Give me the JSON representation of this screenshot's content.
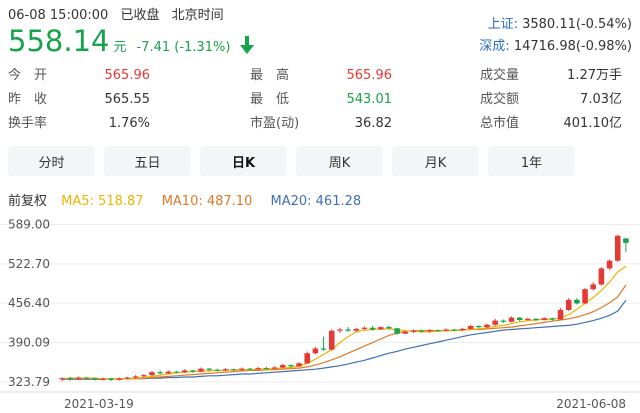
{
  "status": {
    "datetime": "06-08 15:00:00",
    "state": "已收盘",
    "tz": "北京时间"
  },
  "quote": {
    "price": "558.14",
    "unit": "元",
    "change": "-7.41 (-1.31%)",
    "direction_icon": "arrow-down-icon"
  },
  "indices": [
    {
      "name": "上证:",
      "value": "3580.11(-0.54%)"
    },
    {
      "name": "深成:",
      "value": "14716.98(-0.98%)"
    }
  ],
  "stats": [
    [
      {
        "label": "今　开",
        "value": "565.96",
        "color": "red"
      },
      {
        "label": "最　高",
        "value": "565.96",
        "color": "red"
      },
      {
        "label": "成交量",
        "value": "1.27万手",
        "color": "normal"
      }
    ],
    [
      {
        "label": "昨　收",
        "value": "565.55",
        "color": "normal"
      },
      {
        "label": "最　低",
        "value": "543.01",
        "color": "green"
      },
      {
        "label": "成交额",
        "value": "7.03亿",
        "color": "normal"
      }
    ],
    [
      {
        "label": "换手率",
        "value": "1.76%",
        "color": "normal"
      },
      {
        "label": "市盈(动)",
        "value": "36.82",
        "color": "normal"
      },
      {
        "label": "总市值",
        "value": "401.10亿",
        "color": "normal"
      }
    ]
  ],
  "tabs": [
    {
      "label": "分时",
      "active": false
    },
    {
      "label": "五日",
      "active": false
    },
    {
      "label": "日K",
      "active": true
    },
    {
      "label": "周K",
      "active": false
    },
    {
      "label": "月K",
      "active": false
    },
    {
      "label": "1年",
      "active": false
    }
  ],
  "legend": {
    "adjust": "前复权",
    "ma5": "MA5: 518.87",
    "ma10": "MA10: 487.10",
    "ma20": "MA20: 461.28"
  },
  "colors": {
    "up": "#e53935",
    "down": "#16a34a",
    "ma5": "#f0b400",
    "ma10": "#e07a2a",
    "ma20": "#3f6fb5",
    "index_name": "#2a6ebb"
  },
  "chart_data": {
    "type": "candlestick",
    "y_ticks": [
      "589.00",
      "522.70",
      "456.40",
      "390.09",
      "323.79"
    ],
    "ylim": [
      310,
      600
    ],
    "x_labels": [
      "2021-03-19",
      "2021-06-08"
    ],
    "candles": [
      [
        328,
        330,
        325,
        331
      ],
      [
        330,
        329,
        326,
        332
      ],
      [
        329,
        331,
        327,
        333
      ],
      [
        331,
        330,
        328,
        332
      ],
      [
        330,
        328,
        326,
        331
      ],
      [
        328,
        329,
        326,
        331
      ],
      [
        329,
        327,
        325,
        330
      ],
      [
        327,
        329,
        326,
        331
      ],
      [
        329,
        331,
        328,
        332
      ],
      [
        331,
        333,
        329,
        335
      ],
      [
        333,
        335,
        331,
        337
      ],
      [
        335,
        340,
        333,
        342
      ],
      [
        340,
        338,
        336,
        343
      ],
      [
        338,
        341,
        337,
        343
      ],
      [
        341,
        340,
        338,
        342
      ],
      [
        340,
        343,
        339,
        345
      ],
      [
        343,
        341,
        339,
        344
      ],
      [
        341,
        346,
        340,
        348
      ],
      [
        346,
        344,
        342,
        347
      ],
      [
        344,
        343,
        341,
        346
      ],
      [
        343,
        345,
        342,
        347
      ],
      [
        345,
        344,
        342,
        346
      ],
      [
        344,
        346,
        343,
        348
      ],
      [
        346,
        345,
        343,
        347
      ],
      [
        345,
        347,
        344,
        349
      ],
      [
        347,
        346,
        344,
        349
      ],
      [
        346,
        348,
        345,
        350
      ],
      [
        348,
        352,
        347,
        354
      ],
      [
        352,
        350,
        348,
        353
      ],
      [
        350,
        355,
        349,
        357
      ],
      [
        355,
        372,
        354,
        375
      ],
      [
        372,
        380,
        370,
        383
      ],
      [
        380,
        378,
        376,
        400
      ],
      [
        378,
        410,
        377,
        412
      ],
      [
        410,
        412,
        406,
        415
      ],
      [
        412,
        410,
        408,
        416
      ],
      [
        410,
        413,
        408,
        415
      ],
      [
        413,
        415,
        411,
        417
      ],
      [
        415,
        412,
        410,
        418
      ],
      [
        412,
        416,
        411,
        417
      ],
      [
        416,
        414,
        412,
        418
      ],
      [
        414,
        405,
        403,
        415
      ],
      [
        405,
        408,
        404,
        410
      ],
      [
        408,
        410,
        406,
        412
      ],
      [
        410,
        409,
        407,
        412
      ],
      [
        409,
        411,
        407,
        413
      ],
      [
        411,
        410,
        408,
        412
      ],
      [
        410,
        412,
        409,
        414
      ],
      [
        412,
        411,
        409,
        413
      ],
      [
        411,
        413,
        410,
        415
      ],
      [
        413,
        418,
        412,
        420
      ],
      [
        418,
        416,
        414,
        419
      ],
      [
        416,
        420,
        415,
        422
      ],
      [
        420,
        427,
        418,
        430
      ],
      [
        427,
        425,
        423,
        429
      ],
      [
        425,
        432,
        424,
        434
      ],
      [
        432,
        428,
        426,
        433
      ],
      [
        428,
        430,
        427,
        432
      ],
      [
        430,
        428,
        426,
        431
      ],
      [
        428,
        431,
        427,
        433
      ],
      [
        431,
        429,
        427,
        432
      ],
      [
        429,
        445,
        428,
        448
      ],
      [
        445,
        462,
        443,
        465
      ],
      [
        462,
        456,
        454,
        465
      ],
      [
        456,
        480,
        455,
        482
      ],
      [
        480,
        488,
        478,
        492
      ],
      [
        488,
        515,
        486,
        517
      ],
      [
        515,
        528,
        512,
        530
      ],
      [
        528,
        570,
        526,
        572
      ],
      [
        565.55,
        558.14,
        543.01,
        565.96
      ]
    ],
    "ma5": [
      329,
      330,
      330,
      330,
      330,
      329,
      329,
      329,
      329,
      330,
      331,
      333,
      335,
      337,
      339,
      340,
      341,
      342,
      342,
      343,
      343,
      344,
      344,
      344,
      345,
      345,
      346,
      347,
      348,
      350,
      355,
      362,
      370,
      378,
      390,
      400,
      408,
      411,
      412,
      413,
      413,
      412,
      410,
      409,
      408,
      408,
      409,
      410,
      410,
      411,
      412,
      413,
      415,
      417,
      419,
      422,
      425,
      427,
      428,
      429,
      429,
      432,
      437,
      446,
      456,
      466,
      478,
      492,
      509,
      518.87
    ],
    "ma10": [
      329,
      329,
      329,
      329,
      329,
      329,
      329,
      329,
      329,
      329,
      330,
      331,
      332,
      333,
      334,
      335,
      336,
      337,
      338,
      339,
      340,
      341,
      342,
      343,
      343,
      344,
      344,
      345,
      346,
      347,
      349,
      352,
      356,
      361,
      366,
      372,
      378,
      384,
      390,
      396,
      402,
      406,
      409,
      410,
      410,
      410,
      410,
      410,
      411,
      411,
      412,
      412,
      413,
      414,
      415,
      416,
      418,
      420,
      422,
      424,
      426,
      428,
      430,
      433,
      437,
      442,
      449,
      457,
      467,
      487.1
    ],
    "ma20": [
      328,
      328,
      328,
      328,
      328,
      328,
      329,
      329,
      329,
      329,
      329,
      330,
      330,
      331,
      331,
      332,
      332,
      333,
      334,
      334,
      335,
      336,
      337,
      337,
      338,
      339,
      340,
      341,
      342,
      343,
      344,
      345,
      347,
      349,
      351,
      354,
      357,
      360,
      364,
      368,
      372,
      375,
      379,
      382,
      385,
      388,
      391,
      394,
      397,
      400,
      403,
      405,
      407,
      409,
      411,
      412,
      413,
      414,
      415,
      416,
      417,
      418,
      419,
      421,
      424,
      427,
      431,
      436,
      443,
      461.28
    ]
  }
}
